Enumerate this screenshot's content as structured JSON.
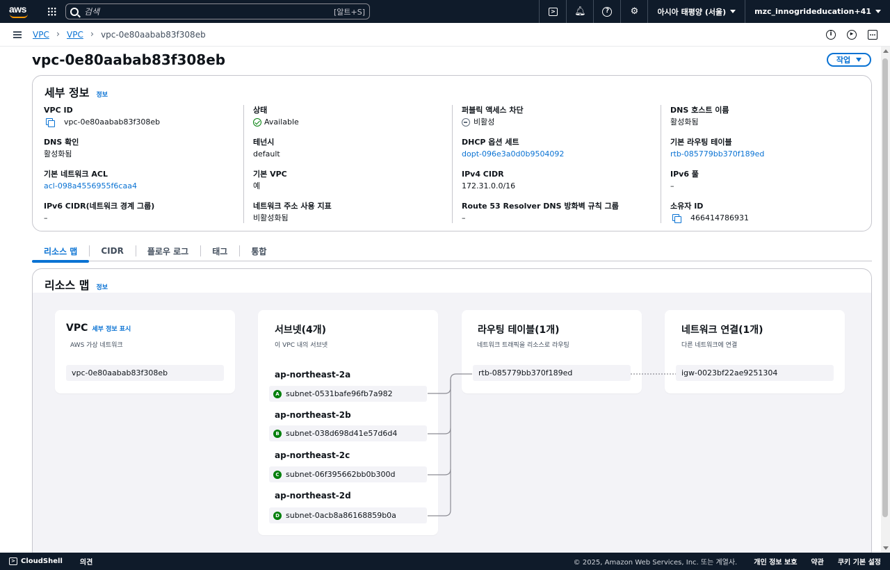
{
  "topnav": {
    "logo": "aws",
    "search_placeholder": "검색",
    "search_shortcut": "[알트+S]",
    "icons": [
      "cloudshell-icon",
      "bell-icon",
      "help-icon",
      "gear-icon"
    ],
    "region": "아시아 태평양 (서울)",
    "account": "mzc_innogrideducation+41"
  },
  "breadcrumb": {
    "items": [
      "VPC",
      "VPC"
    ],
    "current": "vpc-0e80aabab83f308eb"
  },
  "page": {
    "title": "vpc-0e80aabab83f308eb",
    "action_label": "작업"
  },
  "details": {
    "title": "세부 정보",
    "info": "정보",
    "columns": [
      [
        {
          "label": "VPC ID",
          "value": "vpc-0e80aabab83f308eb"
        },
        {
          "label": "DNS 확인",
          "value": "활성화됨"
        },
        {
          "label": "기본 네트워크 ACL",
          "value": "acl-098a4556955f6caa4"
        },
        {
          "label": "IPv6 CIDR(네트워크 경계 그룹)",
          "value": "–"
        }
      ],
      [
        {
          "label": "상태",
          "value": "Available"
        },
        {
          "label": "테넌시",
          "value": "default"
        },
        {
          "label": "기본 VPC",
          "value": "예"
        },
        {
          "label": "네트워크 주소 사용 지표",
          "value": "비활성화됨"
        }
      ],
      [
        {
          "label": "퍼블릭 액세스 차단",
          "value": "비활성"
        },
        {
          "label": "DHCP 옵션 세트",
          "value": "dopt-096e3a0d0b9504092"
        },
        {
          "label": "IPv4 CIDR",
          "value": "172.31.0.0/16"
        },
        {
          "label": "Route 53 Resolver DNS 방화벽 규칙 그룹",
          "value": "–"
        }
      ],
      [
        {
          "label": "DNS 호스트 이름",
          "value": "활성화됨"
        },
        {
          "label": "기본 라우팅 테이블",
          "value": "rtb-085779bb370f189ed"
        },
        {
          "label": "IPv6 풀",
          "value": "–"
        },
        {
          "label": "소유자 ID",
          "value": "466414786931"
        }
      ]
    ]
  },
  "tabs": [
    "리소스 맵",
    "CIDR",
    "플로우 로그",
    "태그",
    "통합"
  ],
  "resource_map": {
    "title": "리소스 맵",
    "info": "정보",
    "vpc": {
      "title": "VPC",
      "link": "세부 정보 표시",
      "subtitle": "AWS 가상 네트워크",
      "item": "vpc-0e80aabab83f308eb"
    },
    "subnets": {
      "title": "서브넷(4개)",
      "subtitle": "이 VPC 내의 서브넷",
      "groups": [
        {
          "az": "ap-northeast-2a",
          "badge": "A",
          "subnet": "subnet-0531bafe96fb7a982"
        },
        {
          "az": "ap-northeast-2b",
          "badge": "B",
          "subnet": "subnet-038d698d41e57d6d4"
        },
        {
          "az": "ap-northeast-2c",
          "badge": "C",
          "subnet": "subnet-06f395662bb0b300d"
        },
        {
          "az": "ap-northeast-2d",
          "badge": "D",
          "subnet": "subnet-0acb8a86168859b0a"
        }
      ]
    },
    "route_tables": {
      "title": "라우팅 테이블(1개)",
      "subtitle": "네트워크 트래픽을 리소스로 라우팅",
      "item": "rtb-085779bb370f189ed"
    },
    "connections": {
      "title": "네트워크 연결(1개)",
      "subtitle": "다른 네트워크에 연결",
      "item": "igw-0023bf22ae9251304"
    }
  },
  "footer": {
    "cloudshell": "CloudShell",
    "feedback": "의견",
    "copyright": "© 2025, Amazon Web Services, Inc. 또는 계열사.",
    "privacy": "개인 정보 보호",
    "terms": "약관",
    "cookies": "쿠키 기본 설정"
  },
  "colors": {
    "nav_bg": "#0f1b2a",
    "link": "#0972d3",
    "success": "#037f0c",
    "border": "#c6c6cd"
  }
}
